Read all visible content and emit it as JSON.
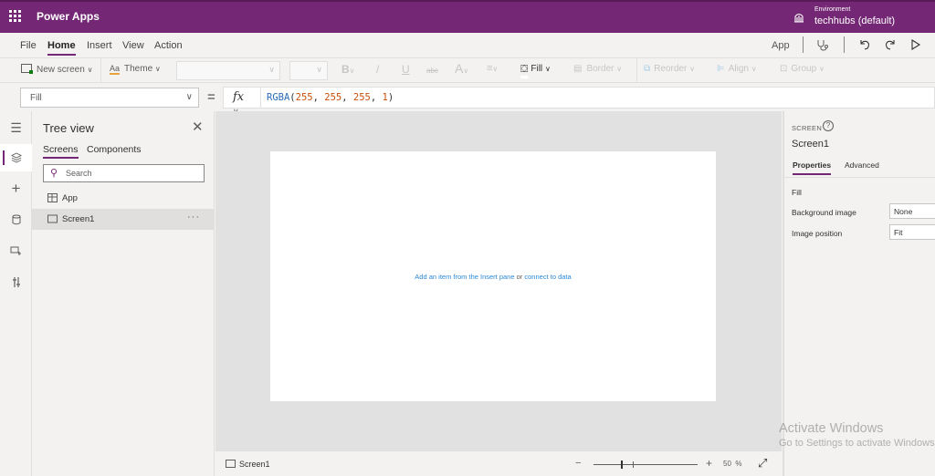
{
  "titlebar": {
    "app_name": "Power Apps",
    "environment_label": "Environment",
    "environment_name": "techhubs (default)",
    "colors": {
      "brand": "#742774"
    }
  },
  "menubar": {
    "items": [
      {
        "label": "File",
        "active": false
      },
      {
        "label": "Home",
        "active": true
      },
      {
        "label": "Insert",
        "active": false
      },
      {
        "label": "View",
        "active": false
      },
      {
        "label": "Action",
        "active": false
      }
    ],
    "right": {
      "app_label": "App",
      "icons": [
        "app-checker-icon",
        "undo-icon",
        "redo-icon",
        "preview-play-icon"
      ]
    }
  },
  "ribbon": {
    "new_screen": "New screen",
    "theme": "Theme",
    "font_select_value": "",
    "font_size_value": "",
    "bold": "B",
    "italic": "/",
    "underline": "U",
    "strikethrough": "abc",
    "font_color": "A",
    "fill": "Fill",
    "border": "Border",
    "reorder": "Reorder",
    "align": "Align",
    "group": "Group"
  },
  "formulabar": {
    "property": "Fill",
    "equals": "=",
    "fx": "fx",
    "formula": {
      "function": "RGBA",
      "args": [
        "255",
        "255",
        "255",
        "1"
      ]
    }
  },
  "rail": {
    "items": [
      "menu-icon",
      "tree-view-icon",
      "insert-icon",
      "data-icon",
      "media-icon",
      "advanced-tools-icon"
    ],
    "active": "tree-view-icon"
  },
  "tree_view": {
    "title": "Tree view",
    "tabs": [
      {
        "label": "Screens",
        "active": true
      },
      {
        "label": "Components",
        "active": false
      }
    ],
    "search_placeholder": "Search",
    "items": [
      {
        "label": "App",
        "icon": "app-icon",
        "selected": false
      },
      {
        "label": "Screen1",
        "icon": "screen-icon",
        "selected": true,
        "more": "···"
      }
    ]
  },
  "canvas": {
    "hint_link1": "Add an item from the Insert pane",
    "hint_or": "or",
    "hint_link2": "connect to data"
  },
  "statusbar": {
    "screen_name": "Screen1",
    "zoom_minus": "−",
    "zoom_plus": "+",
    "zoom_value": "50",
    "zoom_unit": "%",
    "zoom_percent": 50
  },
  "properties": {
    "type_label": "SCREEN",
    "help": "?",
    "name": "Screen1",
    "tabs": [
      {
        "label": "Properties",
        "active": true
      },
      {
        "label": "Advanced",
        "active": false
      }
    ],
    "fields": [
      {
        "label": "Fill",
        "value": null
      },
      {
        "label": "Background image",
        "value": "None"
      },
      {
        "label": "Image position",
        "value": "Fit"
      }
    ]
  },
  "watermark": {
    "line1": "Activate Windows",
    "line2": "Go to Settings to activate Windows."
  }
}
